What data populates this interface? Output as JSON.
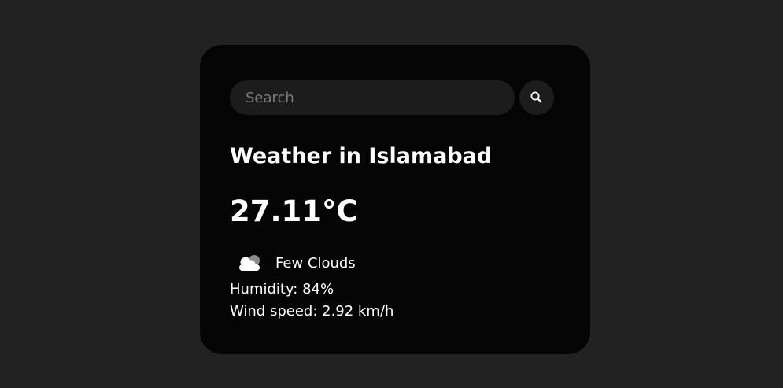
{
  "search": {
    "placeholder": "Search",
    "button_icon": "search-icon"
  },
  "weather": {
    "title": "Weather in Islamabad",
    "temperature": "27.11°C",
    "icon": "few-clouds-icon",
    "description": "Few Clouds",
    "humidity": "Humidity: 84%",
    "wind": "Wind speed: 2.92 km/h"
  },
  "colors": {
    "page_background": "#222222",
    "card_background": "#050505",
    "input_background": "#1c1c1c",
    "text": "#ffffff",
    "placeholder": "#7a7a7a"
  }
}
